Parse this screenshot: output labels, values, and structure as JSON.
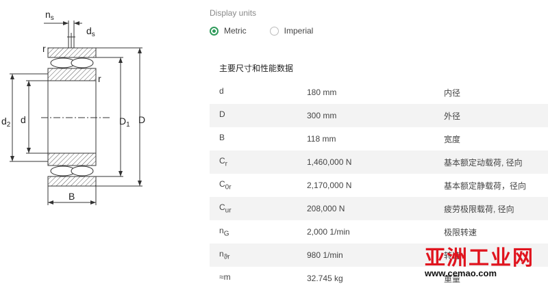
{
  "drawing": {
    "labels": {
      "ns": "n",
      "ns_sub": "s",
      "ds": "d",
      "ds_sub": "s",
      "r1": "r",
      "r2": "r",
      "d2": "d",
      "d2_sub": "2",
      "d": "d",
      "D1": "D",
      "D1_sub": "1",
      "D": "D",
      "B": "B"
    }
  },
  "units": {
    "title": "Display units",
    "metric": "Metric",
    "imperial": "Imperial",
    "selected": "Metric"
  },
  "section_title": "主要尺寸和性能数据",
  "table": {
    "rows": [
      {
        "sym": "d",
        "sub": "",
        "value": "180 mm",
        "desc": "内径"
      },
      {
        "sym": "D",
        "sub": "",
        "value": "300 mm",
        "desc": "外径"
      },
      {
        "sym": "B",
        "sub": "",
        "value": "118 mm",
        "desc": "宽度"
      },
      {
        "sym": "C",
        "sub": "r",
        "value": "1,460,000 N",
        "desc": "基本额定动载荷, 径向"
      },
      {
        "sym": "C",
        "sub": "0r",
        "value": "2,170,000 N",
        "desc": "基本额定静载荷，径向"
      },
      {
        "sym": "C",
        "sub": "ur",
        "value": "208,000 N",
        "desc": "疲劳极限载荷, 径向"
      },
      {
        "sym": "n",
        "sub": "G",
        "value": "2,000 1/min",
        "desc": "极限转速"
      },
      {
        "sym": "n",
        "sub": "ϑr",
        "value": "980 1/min",
        "desc": "转速"
      },
      {
        "sym": "≈m",
        "sub": "",
        "value": "32.745 kg",
        "desc": "重量"
      }
    ]
  },
  "watermark": {
    "cn": "亚洲工业网",
    "url": "www.cemao.com"
  },
  "colors": {
    "accent": "#2e9a5a",
    "row_alt": "#f3f3f3",
    "watermark_red": "#e0141e"
  }
}
